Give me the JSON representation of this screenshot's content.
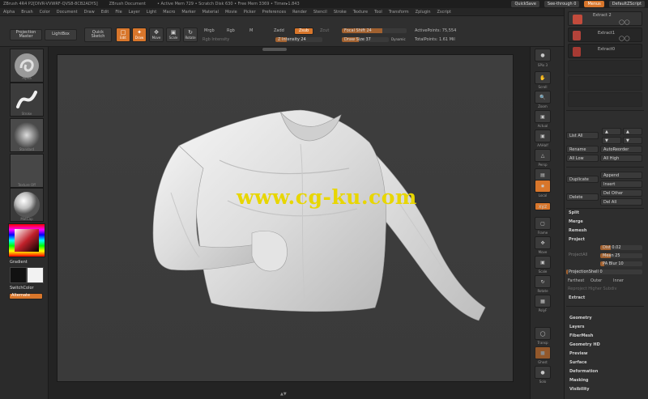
{
  "titlebar": {
    "app": "ZBrush 4R4 P2[DIVR-VVWRF-QVS8-8CB2ADYS]",
    "doc": "ZBrush Document",
    "stats": "• Active Mem 729 • Scratch Disk 630 • Free Mem 3369 • Timer▸1.843",
    "quicksave": "QuickSave",
    "seethrough": "See-through 0",
    "menus": "Menus",
    "script": "DefaultZScript"
  },
  "menubar": [
    "Alpha",
    "Brush",
    "Color",
    "Document",
    "Draw",
    "Edit",
    "File",
    "Layer",
    "Light",
    "Macro",
    "Marker",
    "Material",
    "Movie",
    "Picker",
    "Preferences",
    "Render",
    "Stencil",
    "Stroke",
    "Texture",
    "Tool",
    "Transform",
    "Zplugin",
    "Zscript"
  ],
  "shelf": {
    "projection_master": "Projection Master",
    "lightbox": "LightBox",
    "quick_sketch": "Quick Sketch",
    "edit": "Edit",
    "draw": "Draw",
    "move": "Move",
    "scale": "Scale",
    "rotate": "Rotate",
    "rgb_intensity": "Rgb Intensity",
    "mrgb": "Mrgb",
    "rgb": "Rgb",
    "m": "M",
    "zadd": "Zadd",
    "zsub": "Zsub",
    "zcut": "Zcut",
    "z_intensity": "Z Intensity 24",
    "focal_shift": "Focal Shift 24",
    "draw_size": "Draw Size 37",
    "dynamic": "Dynamic",
    "active_points": "ActivePoints: 75,554",
    "total_points": "TotalPoints: 1.61 Mil"
  },
  "lefttray": {
    "alpha_label": "Alpha",
    "stroke_label": "Stroke",
    "brush_label": "Standard",
    "texture_label": "Texture Off",
    "material_label": "MatCap",
    "gradient": "Gradient",
    "switchcolor": "SwitchColor",
    "alternate": "Alternate"
  },
  "rightstrip": {
    "spix": "SPix 3",
    "scroll": "Scroll",
    "zoom": "Zoom",
    "actual": "Actual",
    "aahalf": "AAHalf",
    "persp": "Persp",
    "floor": "Floor",
    "local": "Local",
    "xyz": "xyz",
    "frame": "Frame",
    "move": "Move",
    "scale": "Scale",
    "rotate": "Rotate",
    "polyf": "PolyF",
    "transp": "Transp",
    "ghost": "Ghost",
    "solo": "Solo"
  },
  "rpanel": {
    "subtools": [
      {
        "name": "Extract 2",
        "active": true
      },
      {
        "name": "Extract1",
        "active": false
      },
      {
        "name": "Extract0",
        "active": false
      },
      {
        "name": "",
        "active": false
      },
      {
        "name": "",
        "active": false
      },
      {
        "name": "",
        "active": false
      }
    ],
    "list_all": "List All",
    "rename": "Rename",
    "autoreorder": "AutoReorder",
    "all_low": "All Low",
    "all_high": "All High",
    "duplicate": "Duplicate",
    "append": "Append",
    "insert": "Insert",
    "delete": "Delete",
    "del_other": "Del Other",
    "del_all": "Del All",
    "split": "Split",
    "merge": "Merge",
    "remesh": "Remesh",
    "project": "Project",
    "projectall": "ProjectAll",
    "dist": "Dist 0.02",
    "mean": "Mean 25",
    "pa_blur": "PA Blur 10",
    "projection_shell": "ProjectionShell 0",
    "farthest": "Farthest",
    "outer": "Outer",
    "inner": "Inner",
    "reproject": "Reproject Higher Subdiv",
    "extract": "Extract",
    "sections": [
      "Geometry",
      "Layers",
      "FiberMesh",
      "Geometry HD",
      "Preview",
      "Surface",
      "Deformation",
      "Masking",
      "Visibility"
    ]
  },
  "watermark": "www.cg-ku.com",
  "colors": {
    "accent": "#d8762b",
    "canvas": "#3c3c3c",
    "panel": "#2e2e2e"
  }
}
